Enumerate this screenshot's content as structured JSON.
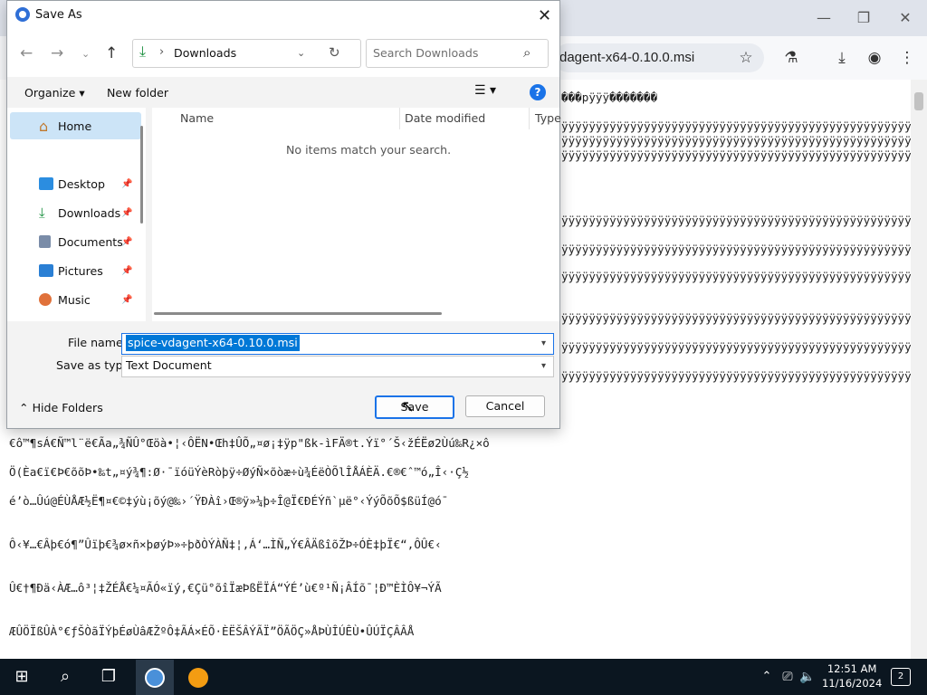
{
  "browser": {
    "tab_title": "dagent-x64-0.10.0.msi",
    "window_controls": [
      "minimize-icon",
      "restore-icon",
      "close-icon"
    ],
    "toolbar_icons": [
      "star-icon",
      "lab-icon",
      "download-icon",
      "account-icon",
      "menu-icon"
    ],
    "content_lines": [
      "���pÿÿÿ�������",
      "ÿÿÿÿÿÿÿÿÿÿÿÿÿÿÿÿÿÿÿÿÿÿÿÿÿÿÿÿÿÿÿÿÿÿÿÿÿÿÿÿÿÿÿÿÿÿÿÿÿÿÿÿÿÿÿÿÿ",
      "ÿÿÿÿÿÿÿÿÿÿÿÿÿÿÿÿÿÿÿÿÿÿÿÿÿÿÿÿÿÿÿÿÿÿÿÿÿÿÿÿÿÿÿÿÿÿÿÿÿÿÿÿÿÿÿÿÿÿÿ",
      "ÿÿÿÿÿÿÿÿÿÿÿÿÿÿÿÿÿÿÿÿÿÿÿÿÿÿÿÿÿÿÿÿÿÿÿÿÿÿÿÿÿÿÿÿÿÿÿÿÿÿÿÿÿÿÿÿÿÿÿ",
      "ÿÿÿÿÿÿÿÿÿÿÿÿÿÿÿÿÿÿÿÿÿÿÿÿÿÿÿÿÿÿÿÿÿÿÿÿÿÿÿÿÿÿÿÿÿÿÿÿÿÿÿÿÿÿÿÿÿÿÿ",
      "ÿÿÿÿÿÿÿÿÿÿÿÿÿÿÿÿÿÿÿÿÿÿÿÿÿÿÿÿÿÿÿÿÿÿÿÿÿÿÿÿÿÿÿÿÿÿÿÿÿÿÿÿÿÿÿÿÿÿÿ",
      "ÿÿÿÿÿÿÿÿÿÿÿÿÿÿÿÿÿÿÿÿÿÿÿÿÿÿÿÿÿÿÿÿÿÿÿÿÿÿÿÿÿÿÿÿÿÿÿÿÿÿÿÿÿÿÿÿÿÿÿ",
      "ÿÿÿÿÿÿÿÿÿÿÿÿÿÿÿÿÿÿÿÿÿÿÿÿÿÿÿÿÿÿÿÿÿÿÿÿÿÿÿÿÿÿÿÿÿÿÿÿÿÿÿÿÿÿÿÿÿÿÿ",
      "ÿÿÿÿÿÿÿÿÿÿÿÿÿÿÿÿÿÿÿÿÿÿÿÿÿÿÿÿÿÿÿÿÿÿÿÿÿÿÿÿÿÿÿÿÿÿÿÿÿÿÿÿÿÿÿÿÿÿÿ",
      "ÿÿÿÿÿÿÿÿÿÿÿÿÿÿÿÿÿÿÿÿÿÿÿÿÿÿÿÿÿÿÿÿÿÿÿÿÿÿÿÿÿÿÿÿÿÿÿÿÿÿÿÿÿÿÿÿÿÿÿ",
      "ÿÿÿÿÿÿÿÿÿÿÿÿÿÿÿÿÿÿÿÿÿÿÿÿÿÿÿÿÿÿÿÿÿÿÿÿÿÿÿÿÿÿÿÿÿÿÿÿÿÿÿÿÿÿÿÿÿÿÿ",
      "ÿÿÿÿÿÿÿÿÿÿÿÿÿÿÿÿÿÿÿÿÿÿÿÿÿÿÿÿÿÿÿÿÿÿÿÿÿÿÿÿÿÿÿÿÿÿÿÿÿÿÿÿÿÿÿÿÿÿÿ",
      "ÿÿÿÿÿÿÿÿÿÿÿÿÿÿÿÿÿÿÿÿÿÿÿÿÿÿÿÿÿÿÿÿÿÿÿÿÿÿÿÿÿÿÿÿÿÿÿÿÿÿÿÿÿÿÿÿÿÿÿ",
      "ÿÿÿÿÿÿÿÿÿÿÿÿÿÿÿÿÿÿÿÿÿÿÿÿÿÿÿÿÿÿÿÿÿÿÿÿÿÿÿÿÿÿÿÿÿÿÿÿÿÿÿÿÿÿÿÿÿÿÿ",
      "ÿÿÿÿÿÿÿÿÿÿÿÿÿÿÿÿÿÿÿÿÿÿÿÿÿÿÿÿÿÿÿÿÿÿÿÿÿÿÿÿÿÿÿÿÿÿÿÿÿÿÿÿÿÿÿÿÿÿÿ",
      "ÿÿÿÿÿÿÿÿÿÿÿÿÿÿÿÿÿÿÿÿÿÿÿÿÿÿÿÿÿÿÿÿÿÿÿÿÿÿÿÿÿÿÿÿÿÿÿÿÿÿÿÿÿÿÿÿÿÿÿ"
    ],
    "lower_lines": [
      "€ô™¶sÁ€Ñ™l¨ë€Ãa„¾ÑÛ°Œöà•¦‹ÔËN•Œh‡ÛÕ„¤ø¡‡ÿp\"ßk-ìFÄ®t.Ýï°´Š‹žÉËø2Ùú‰R¿×ô",
      "Ö(Èa€ï€Þ€õõÞ•‰t„¤ý¾¶:Ø·¯ïóüÝèRòþÿ÷ØýÑ×õòæ÷ù¾ÉëÒÕlÎÅÁÈÄ.€®€ˆ™ó„Î‹·Ç½",
      "é’ò…Ûú@ÉÙÅÆ½Ë¶¤€©‡ýù¡õý@‰›´ŸÐÀî›Œ®ÿ»¼þ÷Î@Ï€ÐÉÝñ`µë°‹ÝýÕõÕ$ßüÍ@ó¯",
      "Ô‹¥…€Âþ€ó¶”Ûïþ€¾ø×ñ×þøýÞ»÷þðÒÝÀÑ‡¦‚Á‘…ÌÑ„Ý€ÂÄßîõŽÞ÷ÓÈ‡þÏ€“‚ÔÛ€‹",
      "Û€†¶Ðä‹ÀÆ…ô³¦‡ŽÉÅ€¼¤ÃÓ«ïý‚€Çü°õîÏæÞßËÏÁ“ÝÉ’ù€º¹Ñ¡ÂÍõ¯¦Ð™ÈÌÔ¥¬ÝÃ",
      "ÆÛÖÏßÛÀ°€ƒŠÒãÏÝþÉøÙâÆŽºÔ‡ÃÁ×ÉÕ·ÈËŠÂÝÃÏ”ÖÃÖÇ»ÅÞÙÎÚÊÙ•ÛÚÏÇÂÂÅ"
    ]
  },
  "dialog": {
    "title": "Save As",
    "breadcrumb": "Downloads",
    "search_placeholder": "Search Downloads",
    "organize_label": "Organize",
    "new_folder_label": "New folder",
    "columns": [
      "Name",
      "Date modified",
      "Type"
    ],
    "empty_message": "No items match your search.",
    "nav_items": [
      {
        "label": "Home",
        "icon": "home-icon",
        "selected": true
      },
      {
        "label": "Desktop",
        "icon": "desktop-icon",
        "pinned": true
      },
      {
        "label": "Downloads",
        "icon": "download-icon",
        "pinned": true
      },
      {
        "label": "Documents",
        "icon": "documents-icon",
        "pinned": true
      },
      {
        "label": "Pictures",
        "icon": "pictures-icon",
        "pinned": true
      },
      {
        "label": "Music",
        "icon": "music-icon",
        "pinned": true
      }
    ],
    "file_name_label": "File name:",
    "file_name_value": "spice-vdagent-x64-0.10.0.msi",
    "save_as_type_label": "Save as type:",
    "save_as_type_value": "Text Document",
    "hide_folders_label": "Hide Folders",
    "save_label": "Save",
    "cancel_label": "Cancel"
  },
  "taskbar": {
    "time": "12:51 AM",
    "date": "11/16/2024",
    "notifications": "2",
    "items": [
      "start-icon",
      "search-icon",
      "task-view-icon",
      "chrome-icon",
      "installer-icon"
    ]
  },
  "colors": {
    "accent": "#1a73e8",
    "selection": "#0078d7",
    "taskbar": "#0b1620",
    "nav_selected": "#cce4f7"
  }
}
